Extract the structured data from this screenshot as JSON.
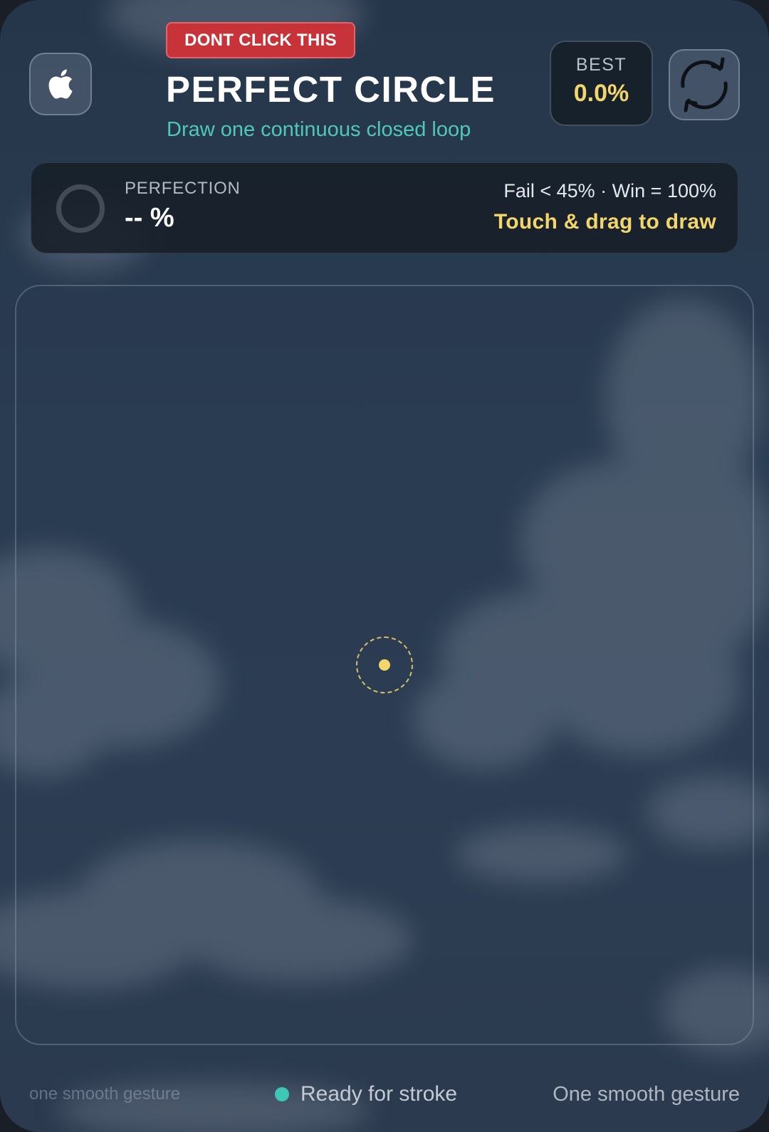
{
  "header": {
    "home_icon": "apple-icon",
    "danger_button_label": "DONT CLICK THIS",
    "title": "PERFECT CIRCLE",
    "subtitle": "Draw one continuous closed loop",
    "best_label": "BEST",
    "best_value": "0.0%",
    "reset_icon": "refresh-icon"
  },
  "status": {
    "perfection_label": "PERFECTION",
    "perfection_value": "-- %",
    "rules": "Fail < 45% · Win = 100%",
    "hint": "Touch & drag to draw"
  },
  "footer": {
    "left_hint": "one smooth gesture",
    "status_text": "Ready for stroke",
    "right_hint": "One smooth gesture"
  },
  "colors": {
    "accent_yellow": "#f3d66b",
    "accent_teal": "#4fc9b7",
    "danger_red": "#c8333a"
  }
}
